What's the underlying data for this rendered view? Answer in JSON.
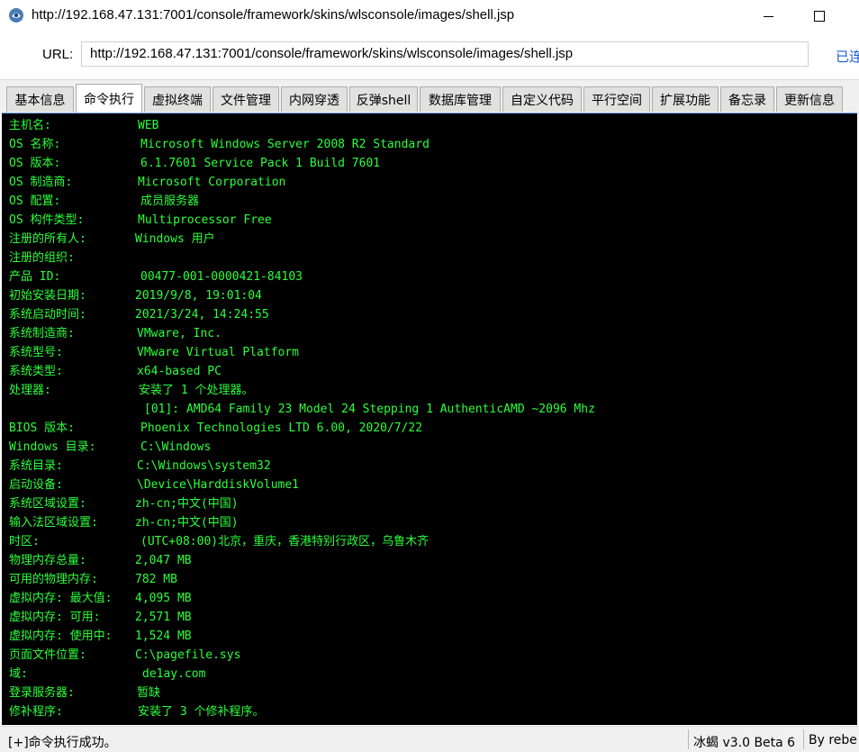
{
  "window": {
    "title": "http://192.168.47.131:7001/console/framework/skins/wlsconsole/images/shell.jsp"
  },
  "urlbar": {
    "label": "URL:",
    "value": "http://192.168.47.131:7001/console/framework/skins/wlsconsole/images/shell.jsp",
    "status": "已连"
  },
  "tabs": [
    {
      "label": "基本信息",
      "active": false
    },
    {
      "label": "命令执行",
      "active": true
    },
    {
      "label": "虚拟终端",
      "active": false
    },
    {
      "label": "文件管理",
      "active": false
    },
    {
      "label": "内网穿透",
      "active": false
    },
    {
      "label": "反弹shell",
      "active": false
    },
    {
      "label": "数据库管理",
      "active": false
    },
    {
      "label": "自定义代码",
      "active": false
    },
    {
      "label": "平行空间",
      "active": false
    },
    {
      "label": "扩展功能",
      "active": false
    },
    {
      "label": "备忘录",
      "active": false
    },
    {
      "label": "更新信息",
      "active": false
    }
  ],
  "terminal": {
    "text_color": "#2cff3a",
    "lines": [
      {
        "key": "主机名:",
        "value": "WEB"
      },
      {
        "key": "OS 名称:",
        "value": "Microsoft Windows Server 2008 R2 Standard"
      },
      {
        "key": "OS 版本:",
        "value": "6.1.7601 Service Pack 1 Build 7601"
      },
      {
        "key": "OS 制造商:",
        "value": "Microsoft Corporation"
      },
      {
        "key": "OS 配置:",
        "value": "成员服务器"
      },
      {
        "key": "OS 构件类型:",
        "value": "Multiprocessor Free"
      },
      {
        "key": "注册的所有人:",
        "value": "Windows 用户"
      },
      {
        "key": "注册的组织:",
        "value": ""
      },
      {
        "key": "产品 ID:",
        "value": "00477-001-0000421-84103"
      },
      {
        "key": "初始安装日期:",
        "value": "2019/9/8, 19:01:04"
      },
      {
        "key": "系统启动时间:",
        "value": "2021/3/24, 14:24:55"
      },
      {
        "key": "系统制造商:",
        "value": "VMware, Inc."
      },
      {
        "key": "系统型号:",
        "value": "VMware Virtual Platform"
      },
      {
        "key": "系统类型:",
        "value": "x64-based PC"
      },
      {
        "key": "处理器:",
        "value": "安装了 1 个处理器。"
      },
      {
        "key": "",
        "value": "[01]: AMD64 Family 23 Model 24 Stepping 1 AuthenticAMD ~2096 Mhz"
      },
      {
        "key": "BIOS 版本:",
        "value": "Phoenix Technologies LTD 6.00, 2020/7/22"
      },
      {
        "key": "Windows 目录:",
        "value": "C:\\Windows"
      },
      {
        "key": "系统目录:",
        "value": "C:\\Windows\\system32"
      },
      {
        "key": "启动设备:",
        "value": "\\Device\\HarddiskVolume1"
      },
      {
        "key": "系统区域设置:",
        "value": "zh-cn;中文(中国)"
      },
      {
        "key": "输入法区域设置:",
        "value": "zh-cn;中文(中国)"
      },
      {
        "key": "时区:",
        "value": "(UTC+08:00)北京，重庆，香港特别行政区，乌鲁木齐"
      },
      {
        "key": "物理内存总量:",
        "value": "2,047 MB"
      },
      {
        "key": "可用的物理内存:",
        "value": "782 MB"
      },
      {
        "key": "虚拟内存: 最大值:",
        "value": "4,095 MB"
      },
      {
        "key": "虚拟内存: 可用:",
        "value": "2,571 MB"
      },
      {
        "key": "虚拟内存: 使用中:",
        "value": "1,524 MB"
      },
      {
        "key": "页面文件位置:",
        "value": "C:\\pagefile.sys"
      },
      {
        "key": "域:",
        "value": "de1ay.com"
      },
      {
        "key": "登录服务器:",
        "value": "暂缺"
      },
      {
        "key": "修补程序:",
        "value": "安装了 3 个修补程序。"
      }
    ]
  },
  "statusbar": {
    "message": "[+]命令执行成功。",
    "version": "冰蝎 v3.0 Beta 6",
    "author": "By rebe"
  }
}
